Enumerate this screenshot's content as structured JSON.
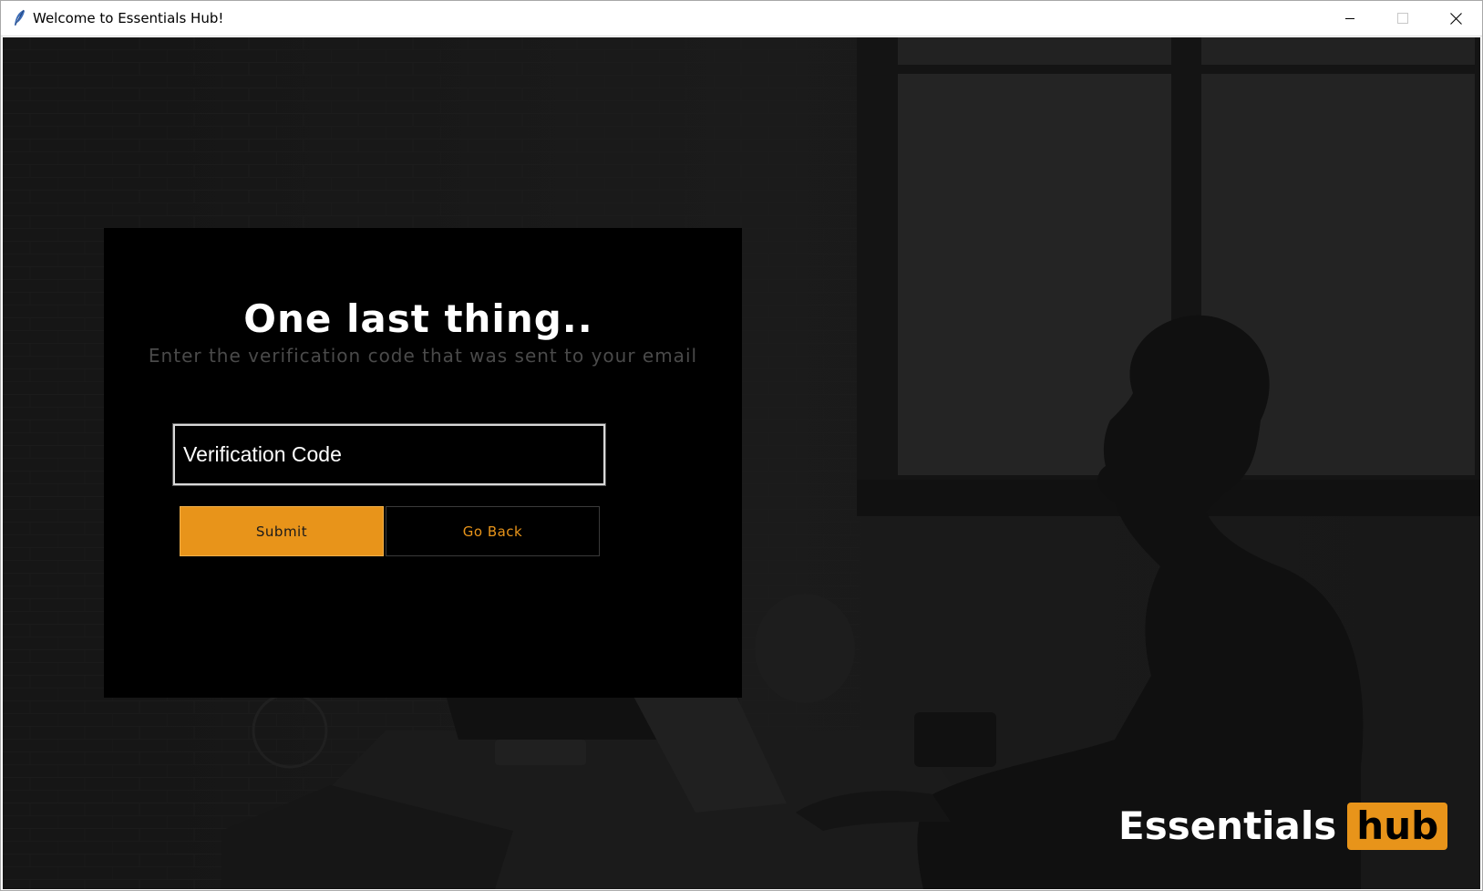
{
  "window": {
    "title": "Welcome to Essentials Hub!",
    "app_icon": "feather-icon",
    "controls": {
      "minimize_icon": "minimize-icon",
      "maximize_icon": "maximize-icon",
      "close_icon": "close-icon"
    }
  },
  "card": {
    "heading": "One last thing..",
    "subheading": "Enter the verification code that was sent to your email",
    "input": {
      "value": "",
      "placeholder": "Verification Code"
    },
    "submit_label": "Submit",
    "back_label": "Go Back"
  },
  "logo": {
    "word": "Essentials",
    "badge": "hub"
  },
  "colors": {
    "accent": "#e8941a",
    "card_background": "#000000",
    "subheading": "#4a4a4a"
  }
}
